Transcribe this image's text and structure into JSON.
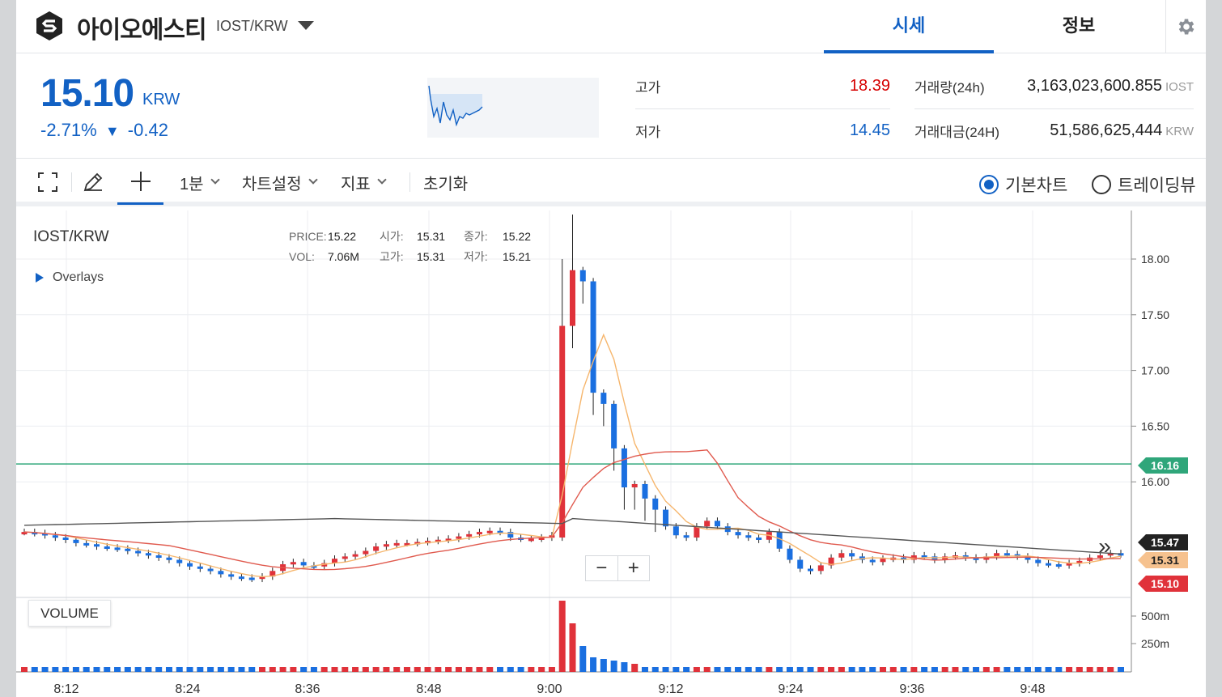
{
  "header": {
    "coin_name": "아이오에스티",
    "pair": "IOST/KRW",
    "tabs": [
      {
        "label": "시세",
        "active": true
      },
      {
        "label": "정보",
        "active": false
      }
    ],
    "settings_icon": "gear-icon"
  },
  "price": {
    "current": "15.10",
    "unit": "KRW",
    "change_percent": "-2.71%",
    "change_arrow": "▼",
    "change_amount": "-0.42",
    "color": "#1261c4"
  },
  "stats": {
    "high_label": "고가",
    "high_value": "18.39",
    "low_label": "저가",
    "low_value": "14.45",
    "volume_label": "거래량(24h)",
    "volume_value": "3,163,023,600.855",
    "volume_unit": "IOST",
    "turnover_label": "거래대금(24H)",
    "turnover_value": "51,586,625,444",
    "turnover_unit": "KRW"
  },
  "toolbar": {
    "interval": "1분",
    "chart_settings": "차트설정",
    "indicators": "지표",
    "reset": "초기화",
    "chart_modes": [
      {
        "label": "기본차트",
        "selected": true
      },
      {
        "label": "트레이딩뷰",
        "selected": false
      }
    ]
  },
  "chart_legend": {
    "pair": "IOST/KRW",
    "price_label": "PRICE:",
    "price_value": "15.22",
    "open_label": "시가:",
    "open_value": "15.31",
    "close_label": "종가:",
    "close_value": "15.22",
    "vol_label": "VOL:",
    "vol_value": "7.06M",
    "high_label": "고가:",
    "high_value": "15.31",
    "low_label": "저가:",
    "low_value": "15.21",
    "overlays": "Overlays",
    "volume": "VOLUME"
  },
  "chart_data": {
    "type": "candlestick",
    "x_ticks": [
      "8:12",
      "8:24",
      "8:36",
      "8:48",
      "9:00",
      "9:12",
      "9:24",
      "9:36",
      "9:48"
    ],
    "y_ticks": [
      "18.00",
      "17.50",
      "17.00",
      "16.50",
      "16.00"
    ],
    "ylim": [
      14.1,
      18.4
    ],
    "volume_ticks": [
      "500m",
      "250m"
    ],
    "markers": [
      {
        "value": "16.16",
        "color": "#2fa67a"
      },
      {
        "value": "15.47",
        "color": "#222222"
      },
      {
        "value": "15.31",
        "color": "#f6c28f"
      },
      {
        "value": "15.10",
        "color": "#e0323a"
      }
    ],
    "up_color": "#e0323a",
    "down_color": "#1a6fe0",
    "grid": true
  }
}
